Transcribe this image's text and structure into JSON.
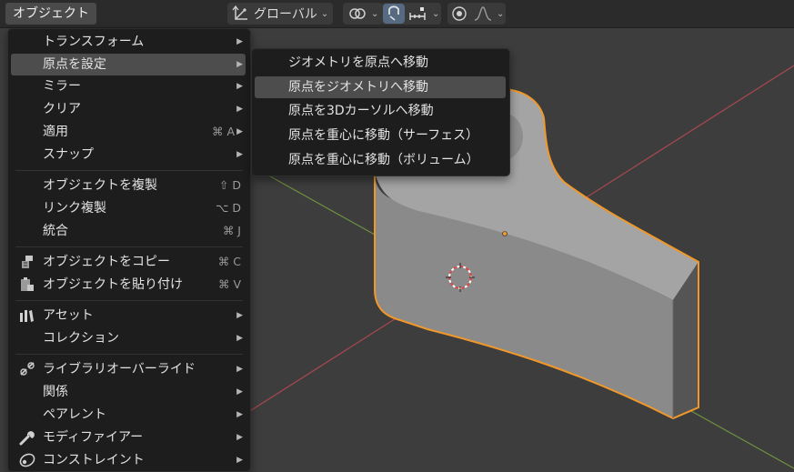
{
  "header": {
    "object_menu_label": "オブジェクト",
    "transform_orientation": "グローバル",
    "icons": [
      "transform-pivot-icon",
      "snap-link-icon",
      "snap-magnet-icon",
      "snap-increment-icon",
      "proportional-edit-icon",
      "falloff-curve-icon"
    ]
  },
  "object_menu": {
    "items": [
      {
        "label": "トランスフォーム",
        "shortcut": "",
        "submenu": true
      },
      {
        "label": "原点を設定",
        "shortcut": "",
        "submenu": true,
        "highlighted": true
      },
      {
        "label": "ミラー",
        "shortcut": "",
        "submenu": true
      },
      {
        "label": "クリア",
        "shortcut": "",
        "submenu": true
      },
      {
        "label": "適用",
        "shortcut": "⌘ A",
        "submenu": true
      },
      {
        "label": "スナップ",
        "shortcut": "",
        "submenu": true
      },
      {
        "label": "オブジェクトを複製",
        "shortcut": "⇧ D"
      },
      {
        "label": "リンク複製",
        "shortcut": "⌥ D"
      },
      {
        "label": "統合",
        "shortcut": "⌘ J"
      },
      {
        "label": "オブジェクトをコピー",
        "shortcut": "⌘ C",
        "icon": "copy-icon"
      },
      {
        "label": "オブジェクトを貼り付け",
        "shortcut": "⌘ V",
        "icon": "paste-icon"
      },
      {
        "label": "アセット",
        "shortcut": "",
        "submenu": true,
        "icon": "asset-library-icon"
      },
      {
        "label": "コレクション",
        "shortcut": "",
        "submenu": true
      },
      {
        "label": "ライブラリオーバーライド",
        "shortcut": "",
        "submenu": true,
        "icon": "library-override-icon"
      },
      {
        "label": "関係",
        "shortcut": "",
        "submenu": true
      },
      {
        "label": "ペアレント",
        "shortcut": "",
        "submenu": true
      },
      {
        "label": "モディファイアー",
        "shortcut": "",
        "submenu": true,
        "icon": "wrench-icon"
      },
      {
        "label": "コンストレイント",
        "shortcut": "",
        "submenu": true,
        "icon": "constraint-icon"
      }
    ]
  },
  "set_origin_submenu": {
    "items": [
      {
        "label": "ジオメトリを原点へ移動"
      },
      {
        "label": "原点をジオメトリへ移動",
        "highlighted": true
      },
      {
        "label": "原点を3Dカーソルへ移動"
      },
      {
        "label": "原点を重心に移動（サーフェス）"
      },
      {
        "label": "原点を重心に移動（ボリューム）"
      }
    ]
  },
  "colors": {
    "viewport_bg": "#3d3d3d",
    "menu_bg": "#1d1d1d",
    "highlight": "#4d4d4d",
    "selection_outline": "#f0982a",
    "x_axis": "#a84850",
    "y_axis": "#6f9040"
  }
}
